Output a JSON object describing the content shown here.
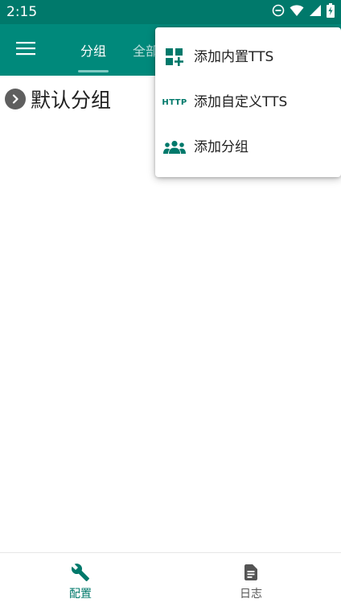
{
  "status_bar": {
    "time": "2:15",
    "icons": [
      "do-not-disturb-icon",
      "wifi-icon",
      "cell-signal-icon",
      "battery-icon"
    ]
  },
  "app_bar": {
    "menu_icon": "hamburger-menu-icon",
    "tabs": [
      {
        "label": "分组",
        "selected": true
      },
      {
        "label": "全部",
        "selected": false
      }
    ]
  },
  "main": {
    "group_title": "默认分组",
    "expand_icon": "chevron-right-icon"
  },
  "popup_menu": {
    "items": [
      {
        "label": "添加内置TTS",
        "icon": "grid-add-icon"
      },
      {
        "label": "添加自定义TTS",
        "icon": "http-icon",
        "icon_text": "HTTP"
      },
      {
        "label": "添加分组",
        "icon": "people-group-icon"
      }
    ]
  },
  "bottom_nav": {
    "items": [
      {
        "label": "配置",
        "icon": "wrench-icon",
        "selected": true
      },
      {
        "label": "日志",
        "icon": "document-icon",
        "selected": false
      }
    ]
  },
  "colors": {
    "status_bar": "#00796b",
    "app_bar": "#00897b",
    "accent": "#00796b",
    "tab_indicator": "#80cbc4"
  }
}
